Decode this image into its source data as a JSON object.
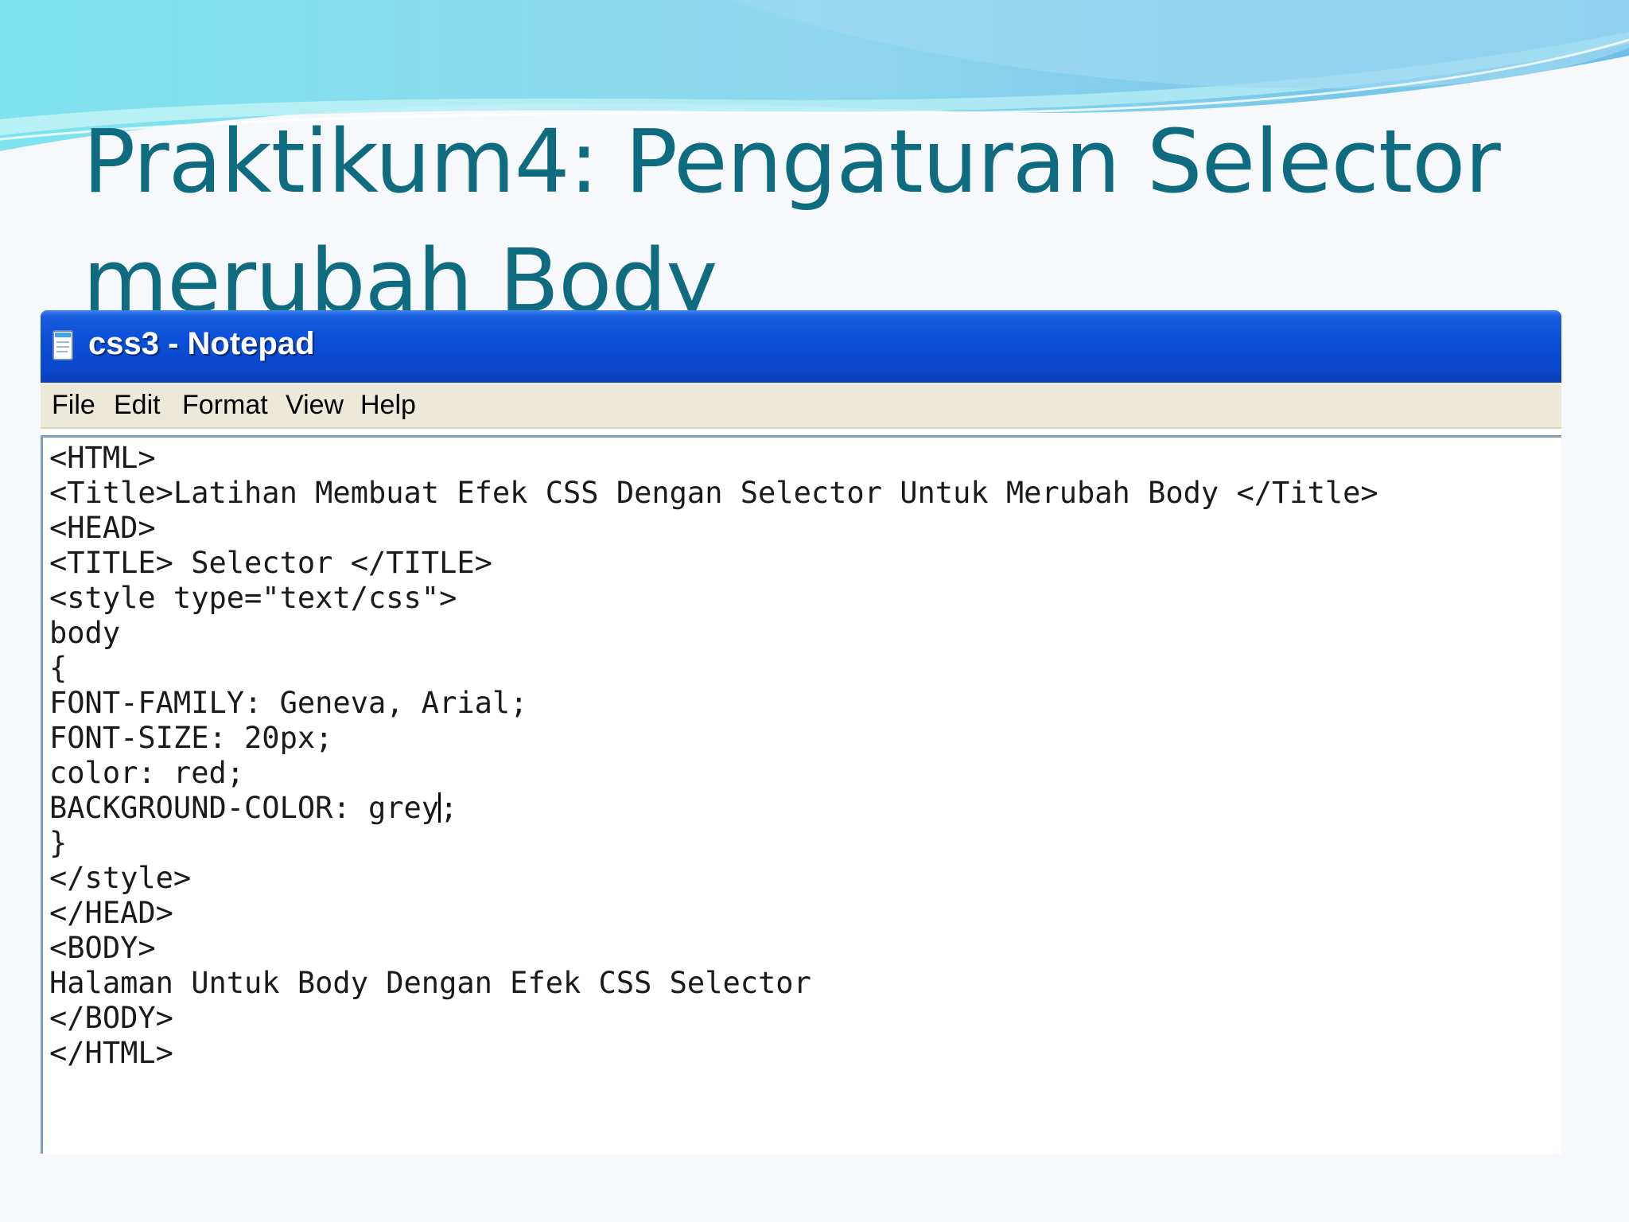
{
  "slide": {
    "title_line1": "Praktikum4: Pengaturan Selector",
    "title_line2": "merubah Body",
    "title_color": "#0e6b80"
  },
  "window": {
    "title": "css3 - Notepad",
    "icon": "notepad-icon",
    "titlebar_color": "#0a4fd6"
  },
  "menu": {
    "items": [
      "File",
      "Edit",
      "Format",
      "View",
      "Help"
    ]
  },
  "editor": {
    "lines": [
      "<HTML>",
      "<Title>Latihan Membuat Efek CSS Dengan Selector Untuk Merubah Body </Title>",
      "<HEAD>",
      "<TITLE> Selector </TITLE>",
      "<style type=\"text/css\">",
      "body",
      "{",
      "FONT-FAMILY: Geneva, Arial;",
      "FONT-SIZE: 20px;",
      "color: red;",
      "BACKGROUND-COLOR: grey",
      "}",
      "</style>",
      "</HEAD>",
      "<BODY>",
      "Halaman Untuk Body Dengan Efek CSS Selector",
      "</BODY>",
      "</HTML>"
    ],
    "caret_line_suffix": ";"
  }
}
